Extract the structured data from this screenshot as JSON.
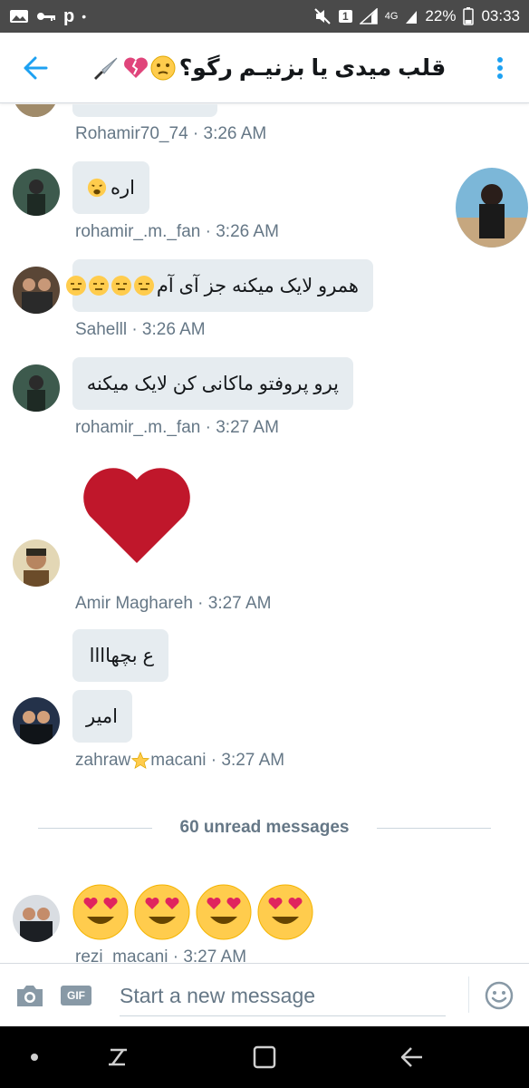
{
  "status_bar": {
    "signal_icon": "signal-icon",
    "network_label": "4G",
    "battery_percent": "22%",
    "time": "03:33",
    "carrier_glyph": "p",
    "sim_badge": "1"
  },
  "header": {
    "title": "قلب میدی یا بزنیـم رگو؟",
    "back_icon": "back-arrow-icon",
    "more_icon": "more-vertical-icon"
  },
  "messages": [
    {
      "meta": "Rohamir70_74 · 3:26 AM"
    },
    {
      "text": "اره",
      "meta": "rohamir_.m._fan · 3:26 AM",
      "emoji": "weary-face"
    },
    {
      "text": "همرو لایک میکنه جز آی آم",
      "meta": "Sahelll · 3:26 AM",
      "emoji": "expressionless-face"
    },
    {
      "text": "پرو پروفتو ماکانی کن لایک میکنه",
      "meta": "rohamir_.m._fan · 3:27 AM"
    },
    {
      "meta": "Amir Maghareh · 3:27 AM",
      "emoji": "red-heart"
    },
    {
      "text1": "ع بچهاااا",
      "text2": "امیر",
      "meta_before": "zahraw",
      "meta_after": "macani · 3:27 AM",
      "emoji": "star"
    },
    {
      "meta": "rezi_macani · 3:27 AM",
      "emoji": "heart-eyes-face"
    }
  ],
  "unread_divider": "60 unread messages",
  "composer": {
    "placeholder": "Start a new message",
    "gif_label": "GIF"
  },
  "colors": {
    "accent": "#1da1f2",
    "bubble": "#e6ecf0",
    "meta_text": "#657786",
    "heart": "#c0172b"
  }
}
